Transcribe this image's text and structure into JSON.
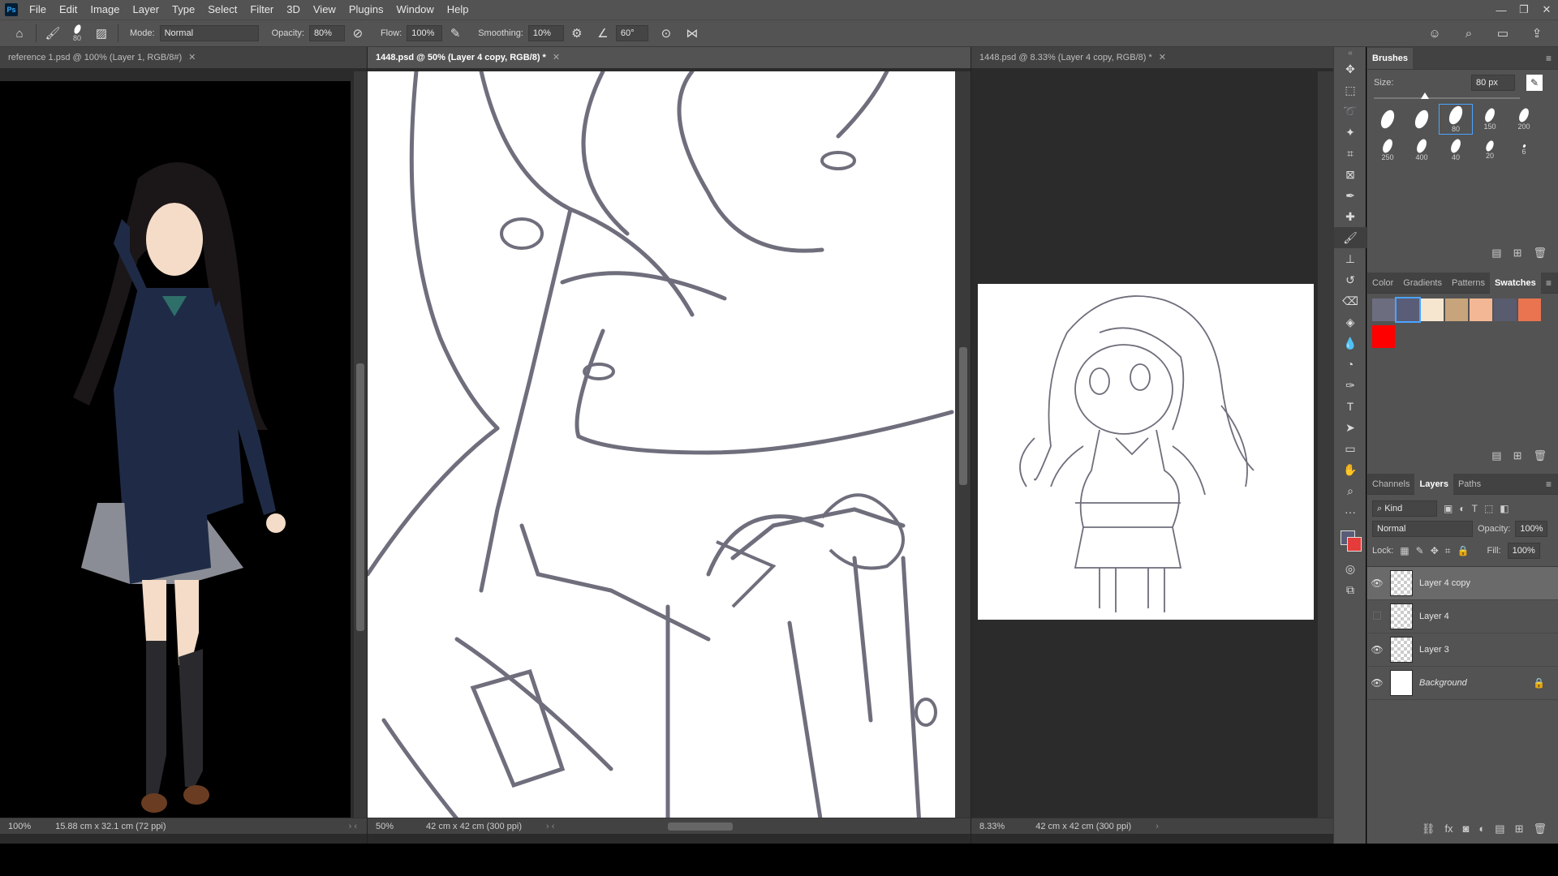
{
  "app": {
    "logo": "Ps"
  },
  "menu": [
    "File",
    "Edit",
    "Image",
    "Layer",
    "Type",
    "Select",
    "Filter",
    "3D",
    "View",
    "Plugins",
    "Window",
    "Help"
  ],
  "window_controls": [
    "—",
    "❐",
    "✕"
  ],
  "options": {
    "brush_size": "80",
    "mode_label": "Mode:",
    "mode_value": "Normal",
    "opacity_label": "Opacity:",
    "opacity_value": "80%",
    "flow_label": "Flow:",
    "flow_value": "100%",
    "smoothing_label": "Smoothing:",
    "smoothing_value": "10%",
    "angle_value": "60°"
  },
  "docs": {
    "left": {
      "tab": "reference 1.psd @ 100% (Layer 1, RGB/8#)",
      "zoom": "100%",
      "size": "15.88 cm x 32.1 cm (72 ppi)"
    },
    "center": {
      "tab": "1448.psd @ 50% (Layer 4 copy, RGB/8) *",
      "zoom": "50%",
      "size": "42 cm x 42 cm (300 ppi)"
    },
    "right": {
      "tab": "1448.psd @ 8.33% (Layer 4 copy, RGB/8) *",
      "zoom": "8.33%",
      "size": "42 cm x 42 cm (300 ppi)"
    }
  },
  "brushes": {
    "title": "Brushes",
    "size_label": "Size:",
    "size_value": "80 px",
    "presets": [
      "",
      "",
      "80",
      "150",
      "200",
      "250",
      "400",
      "40",
      "20",
      "6"
    ]
  },
  "color_tabs": [
    "Color",
    "Gradients",
    "Patterns",
    "Swatches"
  ],
  "swatches": [
    "#6d6d80",
    "#5a5d78",
    "#f6e6cf",
    "#c8a47c",
    "#f3b796",
    "#595b6e",
    "#e9744f",
    "#ff0000"
  ],
  "layers_tabs": [
    "Channels",
    "Layers",
    "Paths"
  ],
  "layers_panel": {
    "kind_label": "Kind",
    "blend_mode": "Normal",
    "opacity_label": "Opacity:",
    "opacity_value": "100%",
    "lock_label": "Lock:",
    "fill_label": "Fill:",
    "fill_value": "100%"
  },
  "layers": [
    {
      "name": "Layer 4 copy",
      "visible": true,
      "selected": true
    },
    {
      "name": "Layer 4",
      "visible": false,
      "selected": false
    },
    {
      "name": "Layer 3",
      "visible": true,
      "selected": false
    },
    {
      "name": "Background",
      "visible": true,
      "selected": false
    }
  ]
}
